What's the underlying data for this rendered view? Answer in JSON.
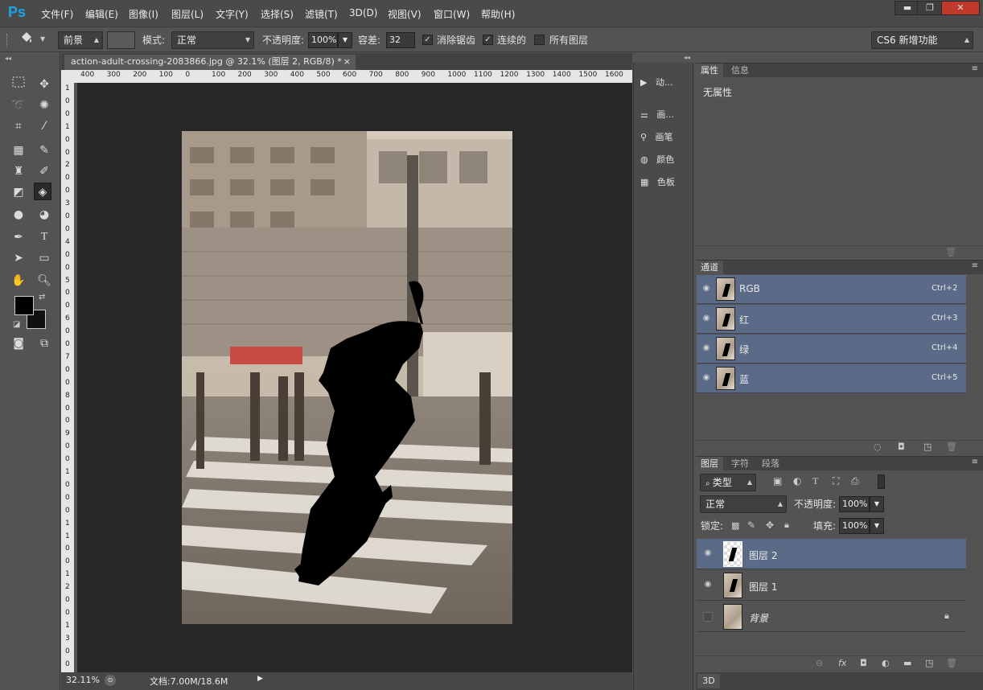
{
  "app": {
    "logo": "Ps"
  },
  "menu": [
    "文件(F)",
    "编辑(E)",
    "图像(I)",
    "图层(L)",
    "文字(Y)",
    "选择(S)",
    "滤镜(T)",
    "3D(D)",
    "视图(V)",
    "窗口(W)",
    "帮助(H)"
  ],
  "window_controls": {
    "minimize": "▬",
    "restore": "❐",
    "close": "✕"
  },
  "options": {
    "fill_source": "前景",
    "mode_label": "模式:",
    "mode_value": "正常",
    "opacity_label": "不透明度:",
    "opacity_value": "100%",
    "tolerance_label": "容差:",
    "tolerance_value": "32",
    "antialias_label": "消除锯齿",
    "contiguous_label": "连续的",
    "all_layers_label": "所有图层",
    "workspace": "CS6 新增功能"
  },
  "document": {
    "tab_title": "action-adult-crossing-2083866.jpg @ 32.1% (图层 2, RGB/8) *",
    "tab_close": "×",
    "zoom": "32.11%",
    "doc_size": "文档:7.00M/18.6M"
  },
  "ruler_h": [
    "400",
    "300",
    "200",
    "100",
    "0",
    "100",
    "200",
    "300",
    "400",
    "500",
    "600",
    "700",
    "800",
    "900",
    "1000",
    "1100",
    "1200",
    "1300",
    "1400",
    "1500",
    "1600"
  ],
  "ruler_v": [
    "1",
    "0",
    "0",
    "1",
    "0",
    "0",
    "2",
    "0",
    "0",
    "3",
    "0",
    "0",
    "4",
    "0",
    "0",
    "5",
    "0",
    "0",
    "6",
    "0",
    "0",
    "7",
    "0",
    "0",
    "8",
    "0",
    "0",
    "9",
    "0",
    "0",
    "1",
    "0",
    "0",
    "0",
    "1",
    "1",
    "0",
    "0",
    "1",
    "2",
    "0",
    "0",
    "1",
    "3",
    "0",
    "0"
  ],
  "strip": {
    "actions": "动...",
    "brush_presets": "画...",
    "brush": "画笔",
    "color": "颜色",
    "swatches": "色板"
  },
  "properties_panel": {
    "tab_properties": "属性",
    "tab_info": "信息",
    "content": "无属性"
  },
  "channels_panel": {
    "tab": "通道",
    "channels": [
      {
        "name": "RGB",
        "shortcut": "Ctrl+2"
      },
      {
        "name": "红",
        "shortcut": "Ctrl+3"
      },
      {
        "name": "绿",
        "shortcut": "Ctrl+4"
      },
      {
        "name": "蓝",
        "shortcut": "Ctrl+5"
      }
    ]
  },
  "layers_panel": {
    "tab_layers": "图层",
    "tab_character": "字符",
    "tab_paragraph": "段落",
    "filter_kind": "类型",
    "blend_mode": "正常",
    "opacity_label": "不透明度:",
    "opacity_value": "100%",
    "lock_label": "锁定:",
    "fill_label": "填充:",
    "fill_value": "100%",
    "layers": [
      {
        "name": "图层 2",
        "selected": true,
        "visible": true
      },
      {
        "name": "图层 1",
        "selected": false,
        "visible": true
      },
      {
        "name": "背景",
        "selected": false,
        "visible": false,
        "locked": true
      }
    ],
    "footer": [
      "fx"
    ]
  },
  "bottom_tab": "3D",
  "colors": {
    "accent": "#1ea4e6",
    "selection": "#5b6b87",
    "panel_bg": "#535353",
    "canvas_bg": "#282828"
  }
}
